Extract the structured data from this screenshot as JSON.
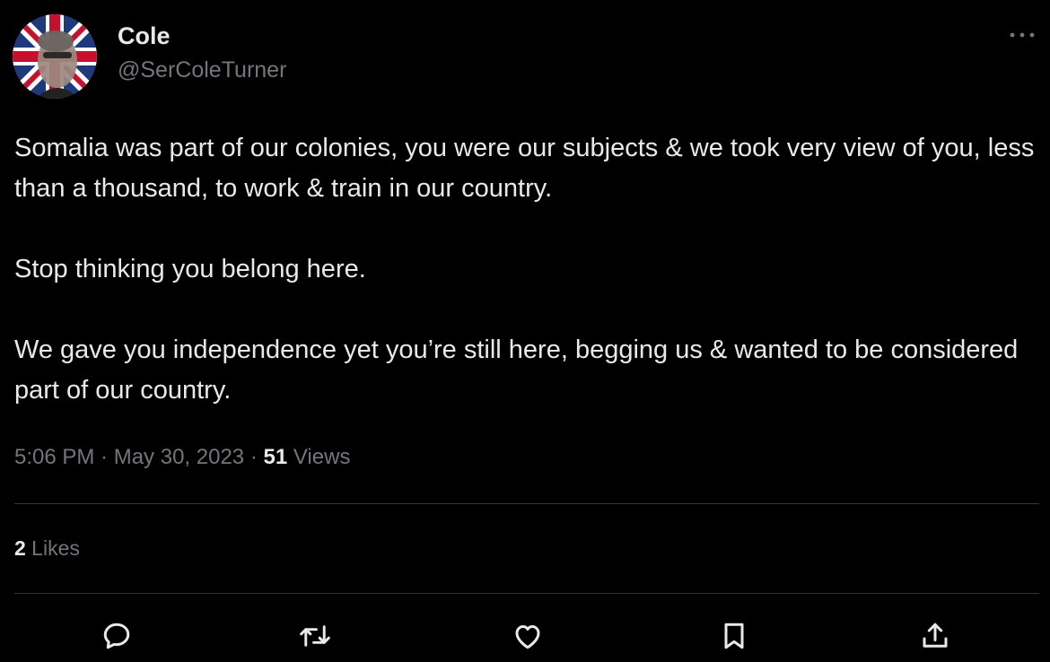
{
  "author": {
    "display_name": "Cole",
    "handle": "@SerColeTurner"
  },
  "tweet": {
    "paragraphs": [
      "Somalia was part of our colonies, you were our subjects & we took very view of you, less than a thousand, to work & train in our country.",
      "Stop thinking you belong here.",
      "We gave you independence yet you’re still here, begging us & wanted to be considered part of our country."
    ]
  },
  "meta": {
    "time": "5:06 PM",
    "separator": " · ",
    "date": "May 30, 2023",
    "views_count": "51",
    "views_label": " Views"
  },
  "engagement": {
    "likes_count": "2",
    "likes_label": " Likes"
  },
  "actions": [
    "reply-icon",
    "retweet-icon",
    "like-icon",
    "bookmark-icon",
    "share-icon"
  ],
  "colors": {
    "background": "#000000",
    "primary_text": "#e7e9ea",
    "secondary_text": "#71767b",
    "divider": "#2f3336"
  }
}
